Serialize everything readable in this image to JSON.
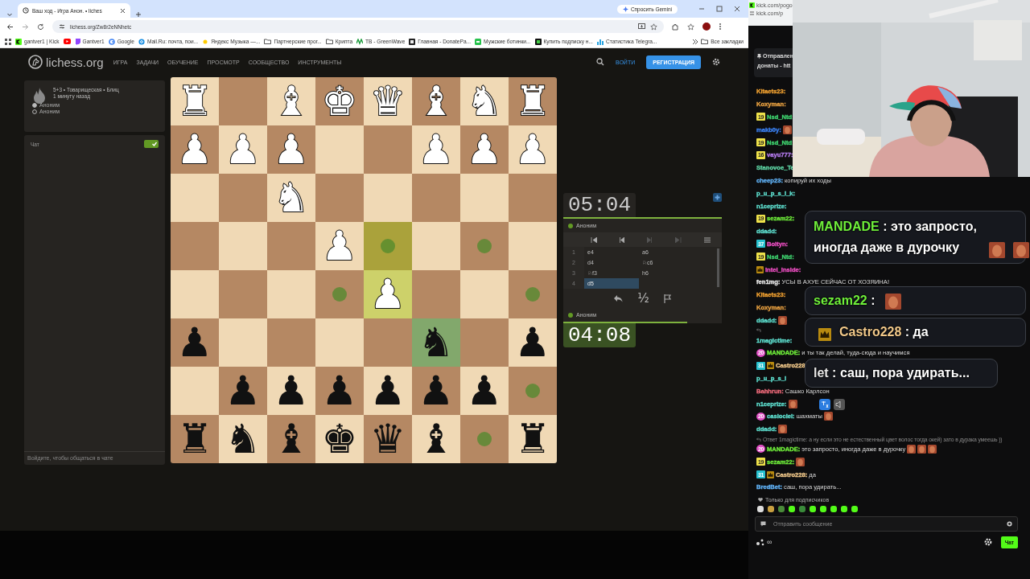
{
  "browser": {
    "tab_title": "Ваш ход - Игра Анон. • liches",
    "url": "lichess.org/Zw8r2eNNhetc",
    "gemini_button": "Спросить Gemini",
    "bookmarks": [
      {
        "kind": "kick",
        "label": "gantver1 | Kick"
      },
      {
        "kind": "youtube"
      },
      {
        "kind": "twitch",
        "label": "Gantver1"
      },
      {
        "kind": "google",
        "label": "Google"
      },
      {
        "kind": "mail",
        "label": "Mail.Ru: почта, пои..."
      },
      {
        "kind": "yandex",
        "label": "Яндекс Музыка —..."
      },
      {
        "kind": "folder",
        "label": "Партнерские прог..."
      },
      {
        "kind": "folder",
        "label": "Крипта"
      },
      {
        "kind": "greenwave",
        "label": "TB - GreenWave"
      },
      {
        "kind": "donate",
        "label": "Главная - DonatePa..."
      },
      {
        "kind": "shoe",
        "label": "Мужские ботинки..."
      },
      {
        "kind": "bot",
        "label": "Купить подписку н..."
      },
      {
        "kind": "stats",
        "label": "Статистика Telegra..."
      }
    ],
    "all_bookmarks": "Все закладки"
  },
  "site": {
    "logo": "lichess.org",
    "nav": [
      "ИГРА",
      "ЗАДАЧИ",
      "ОБУЧЕНИЕ",
      "ПРОСМОТР",
      "СООБЩЕСТВО",
      "ИНСТРУМЕНТЫ"
    ],
    "login": "ВОЙТИ",
    "signup": "РЕГИСТРАЦИЯ"
  },
  "game": {
    "info": "5+3 • Товарищеская • Блиц",
    "time_ago": "1 минуту назад",
    "players": [
      {
        "name": "Аноним",
        "white": true
      },
      {
        "name": "Аноним",
        "white": false
      }
    ]
  },
  "chat": {
    "title": "Чат",
    "on": true,
    "hint": "Войдите, чтобы общаться в чате"
  },
  "board": {
    "rows": [
      [
        {
          "piece": "♜",
          "white": true,
          "dot": false,
          "last_move": false,
          "selected": false
        },
        {
          "dot": false,
          "last_move": false,
          "selected": false
        },
        {
          "piece": "♝",
          "white": true,
          "dot": false,
          "last_move": false,
          "selected": false
        },
        {
          "piece": "♚",
          "white": true,
          "dot": false,
          "last_move": false,
          "selected": false
        },
        {
          "piece": "♛",
          "white": true,
          "dot": false,
          "last_move": false,
          "selected": false
        },
        {
          "piece": "♝",
          "white": true,
          "dot": false,
          "last_move": false,
          "selected": false
        },
        {
          "piece": "♞",
          "white": true,
          "dot": false,
          "last_move": false,
          "selected": false
        },
        {
          "piece": "♜",
          "white": true,
          "dot": false,
          "last_move": false,
          "selected": false
        }
      ],
      [
        {
          "piece": "♟",
          "white": true,
          "dot": false,
          "last_move": false,
          "selected": false
        },
        {
          "piece": "♟",
          "white": true,
          "dot": false,
          "last_move": false,
          "selected": false
        },
        {
          "piece": "♟",
          "white": true,
          "dot": false,
          "last_move": false,
          "selected": false
        },
        {
          "dot": false,
          "last_move": false,
          "selected": false
        },
        {
          "dot": false,
          "last_move": false,
          "selected": false
        },
        {
          "piece": "♟",
          "white": true,
          "dot": false,
          "last_move": false,
          "selected": false
        },
        {
          "piece": "♟",
          "white": true,
          "dot": false,
          "last_move": false,
          "selected": false
        },
        {
          "piece": "♟",
          "white": true,
          "dot": false,
          "last_move": false,
          "selected": false
        }
      ],
      [
        {
          "dot": false,
          "last_move": false,
          "selected": false
        },
        {
          "dot": false,
          "last_move": false,
          "selected": false
        },
        {
          "piece": "♞",
          "white": true,
          "dot": false,
          "last_move": false,
          "selected": false
        },
        {
          "dot": false,
          "last_move": false,
          "selected": false
        },
        {
          "dot": false,
          "last_move": false,
          "selected": false
        },
        {
          "dot": false,
          "last_move": false,
          "selected": false
        },
        {
          "dot": false,
          "last_move": false,
          "selected": false
        },
        {
          "dot": false,
          "last_move": false,
          "selected": false
        }
      ],
      [
        {
          "dot": false,
          "last_move": false,
          "selected": false
        },
        {
          "dot": false,
          "last_move": false,
          "selected": false
        },
        {
          "dot": false,
          "last_move": false,
          "selected": false
        },
        {
          "piece": "♟",
          "white": true,
          "dot": false,
          "last_move": false,
          "selected": false
        },
        {
          "dot": true,
          "last_move": true,
          "selected": false
        },
        {
          "dot": false,
          "last_move": false,
          "selected": false
        },
        {
          "dot": true,
          "last_move": false,
          "selected": false
        },
        {
          "dot": false,
          "last_move": false,
          "selected": false
        }
      ],
      [
        {
          "dot": false,
          "last_move": false,
          "selected": false
        },
        {
          "dot": false,
          "last_move": false,
          "selected": false
        },
        {
          "dot": false,
          "last_move": false,
          "selected": false
        },
        {
          "dot": true,
          "last_move": false,
          "selected": false
        },
        {
          "piece": "♟",
          "white": true,
          "dot": false,
          "last_move": true,
          "selected": false
        },
        {
          "dot": false,
          "last_move": false,
          "selected": false
        },
        {
          "dot": false,
          "last_move": false,
          "selected": false
        },
        {
          "dot": true,
          "last_move": false,
          "selected": false
        }
      ],
      [
        {
          "piece": "♟",
          "white": false,
          "dot": false,
          "last_move": false,
          "selected": false
        },
        {
          "dot": false,
          "last_move": false,
          "selected": false
        },
        {
          "dot": false,
          "last_move": false,
          "selected": false
        },
        {
          "dot": false,
          "last_move": false,
          "selected": false
        },
        {
          "dot": false,
          "last_move": false,
          "selected": false
        },
        {
          "piece": "♞",
          "white": false,
          "dot": false,
          "last_move": false,
          "selected": true
        },
        {
          "dot": false,
          "last_move": false,
          "selected": false
        },
        {
          "piece": "♟",
          "white": false,
          "dot": false,
          "last_move": false,
          "selected": false
        }
      ],
      [
        {
          "dot": false,
          "last_move": false,
          "selected": false
        },
        {
          "piece": "♟",
          "white": false,
          "dot": false,
          "last_move": false,
          "selected": false
        },
        {
          "piece": "♟",
          "white": false,
          "dot": false,
          "last_move": false,
          "selected": false
        },
        {
          "piece": "♟",
          "white": false,
          "dot": false,
          "last_move": false,
          "selected": false
        },
        {
          "piece": "♟",
          "white": false,
          "dot": false,
          "last_move": false,
          "selected": false
        },
        {
          "piece": "♟",
          "white": false,
          "dot": false,
          "last_move": false,
          "selected": false
        },
        {
          "piece": "♟",
          "white": false,
          "dot": false,
          "last_move": false,
          "selected": false
        },
        {
          "dot": true,
          "last_move": false,
          "selected": false
        }
      ],
      [
        {
          "piece": "♜",
          "white": false,
          "dot": false,
          "last_move": false,
          "selected": false
        },
        {
          "piece": "♞",
          "white": false,
          "dot": false,
          "last_move": false,
          "selected": false
        },
        {
          "piece": "♝",
          "white": false,
          "dot": false,
          "last_move": false,
          "selected": false
        },
        {
          "piece": "♚",
          "white": false,
          "dot": false,
          "last_move": false,
          "selected": false
        },
        {
          "piece": "♛",
          "white": false,
          "dot": false,
          "last_move": false,
          "selected": false
        },
        {
          "piece": "♝",
          "white": false,
          "dot": false,
          "last_move": false,
          "selected": false
        },
        {
          "dot": true,
          "last_move": false,
          "selected": false
        },
        {
          "piece": "♜",
          "white": false,
          "dot": false,
          "last_move": false,
          "selected": false
        }
      ]
    ]
  },
  "clocks": [
    {
      "player": "Аноним",
      "time": "05:04",
      "active": false,
      "level": 1
    },
    {
      "player": "Аноним",
      "time": "04:08",
      "active": true,
      "level": 0.78
    }
  ],
  "moves": [
    {
      "number": "1",
      "plies": [
        {
          "san": "e4",
          "selected": false
        },
        {
          "san": "a6",
          "selected": false
        }
      ]
    },
    {
      "number": "2",
      "plies": [
        {
          "san": "d4",
          "selected": false
        },
        {
          "san": "♘c6",
          "selected": false
        }
      ]
    },
    {
      "number": "3",
      "plies": [
        {
          "san": "♘f3",
          "selected": false
        },
        {
          "san": "h6",
          "selected": false
        }
      ]
    },
    {
      "number": "4",
      "plies": [
        {
          "san": "d5",
          "selected": true
        }
      ]
    }
  ],
  "draw_offer": "½",
  "stream": {
    "kick_urls": [
      "kick.com/pogo",
      "kick.com/p"
    ],
    "pinned": [
      "Отправлен",
      "донаты - htt"
    ],
    "messages": [
      {
        "kind": "message",
        "user": "Kitaets23:",
        "color": "#f0a030"
      },
      {
        "kind": "message",
        "user": "Koxyman:",
        "color": "#e8a040"
      },
      {
        "kind": "message",
        "user": "Nsd_Ntd:",
        "color": "#3fd46f",
        "badges": [
          {
            "kind": "gold",
            "label": "19"
          }
        ]
      },
      {
        "kind": "message",
        "user": "makb0y:",
        "color": "#3b82f6",
        "emotes": [
          {
            "kind": "face"
          }
        ]
      },
      {
        "kind": "message",
        "user": "Nsd_Ntd:",
        "color": "#3fd46f",
        "badges": [
          {
            "kind": "gold",
            "label": "19"
          }
        ]
      },
      {
        "kind": "message",
        "user": "vayu777:",
        "color": "#b67cf0",
        "badges": [
          {
            "kind": "gold",
            "label": "16"
          }
        ]
      },
      {
        "kind": "message",
        "user": "Stanovoe_Te",
        "color": "#5fd6a5"
      },
      {
        "kind": "message",
        "user": "cheep23:",
        "color": "#61b3f8",
        "text": "копируй их ходы"
      },
      {
        "kind": "message",
        "user": "p_u_p_s_i_k:",
        "color": "#5ee0d0"
      },
      {
        "kind": "message",
        "user": "n1ceprize:",
        "color": "#5ee0d0"
      },
      {
        "kind": "message",
        "user": "sezam22:",
        "color": "#6fef3a",
        "badges": [
          {
            "kind": "gold",
            "label": "19"
          }
        ]
      },
      {
        "kind": "message",
        "user": "ddadd:",
        "color": "#5ee0d0"
      },
      {
        "kind": "message",
        "user": "Boltyn:",
        "color": "#ef4fc4",
        "badges": [
          {
            "kind": "teal",
            "label": "37"
          }
        ]
      },
      {
        "kind": "message",
        "user": "Nsd_Ntd:",
        "color": "#3fd46f",
        "badges": [
          {
            "kind": "gold",
            "label": "19"
          }
        ]
      },
      {
        "kind": "message",
        "user": "intel_inside:",
        "color": "#ef4fc4",
        "badges": [
          {
            "kind": "crown"
          }
        ]
      },
      {
        "kind": "message",
        "user": "fen1mg:",
        "color": "#e8e8e8",
        "text": "УСЫ В АХУЕ СЕЙЧАС ОТ ХОЗЯИНА!"
      },
      {
        "kind": "message",
        "user": "Kitaets23:",
        "color": "#f0a030"
      },
      {
        "kind": "message",
        "user": "Koxyman:",
        "color": "#e8a040"
      },
      {
        "kind": "message",
        "user": "ddadd:",
        "color": "#5ee0d0",
        "emotes": [
          {
            "kind": "face"
          }
        ]
      },
      {
        "kind": "reply"
      },
      {
        "kind": "message",
        "user": "1magictime:",
        "color": "#5ee0d0"
      },
      {
        "kind": "message",
        "user": "MANDADE:",
        "color": "#6fef3a",
        "badges": [
          {
            "kind": "pink",
            "label": "20"
          }
        ],
        "text": "и ты так делай, туда-сюда и научимся"
      },
      {
        "kind": "message",
        "user": "Castro228:",
        "color": "#f2c98a",
        "badges": [
          {
            "kind": "teal",
            "label": "31"
          },
          {
            "kind": "crown"
          }
        ]
      },
      {
        "kind": "message",
        "user": "p_u_p_s_i",
        "color": "#5ee0d0"
      },
      {
        "kind": "message",
        "user": "Bahhrun:",
        "color": "#ef6a7a",
        "text": "Сашко Карлсон"
      },
      {
        "kind": "message",
        "user": "n1ceprize:",
        "color": "#5ee0d0",
        "emotes": [
          {
            "kind": "face"
          }
        ]
      },
      {
        "kind": "message",
        "user": "casiociel:",
        "color": "#5ee0d0",
        "badges": [
          {
            "kind": "pink",
            "label": "20"
          }
        ],
        "text": "шахматы",
        "emotes": [
          {
            "kind": "face"
          }
        ]
      },
      {
        "kind": "message",
        "user": "ddadd:",
        "color": "#5ee0d0",
        "emotes": [
          {
            "kind": "face"
          }
        ]
      },
      {
        "kind": "reply",
        "text": "Ответ 1magictime: а ну если это не естественный цвет волос тогда окей) зато в дурака умеешь ))"
      },
      {
        "kind": "message",
        "user": "MANDADE:",
        "color": "#6fef3a",
        "badges": [
          {
            "kind": "pink",
            "label": "20"
          }
        ],
        "text": "это запросто, иногда даже в дурочку",
        "emotes": [
          {
            "kind": "face"
          },
          {
            "kind": "face"
          },
          {
            "kind": "face"
          }
        ]
      },
      {
        "kind": "message",
        "user": "sezam22:",
        "color": "#6fef3a",
        "badges": [
          {
            "kind": "gold",
            "label": "19"
          }
        ],
        "emotes": [
          {
            "kind": "face"
          }
        ]
      },
      {
        "kind": "message",
        "user": "Castro228:",
        "color": "#f2c98a",
        "badges": [
          {
            "kind": "teal",
            "label": "31"
          },
          {
            "kind": "crown"
          }
        ],
        "text": "да"
      },
      {
        "kind": "message",
        "user": "BredBet:",
        "color": "#61b3f8",
        "text": "саш, пора удирать..."
      }
    ],
    "overlays": [
      {
        "user": "MANDADE",
        "color": "#6fef3a",
        "text": " : это запросто, иногда даже в дурочку",
        "emotes": [
          {
            "kind": "face"
          },
          {
            "kind": "face"
          }
        ]
      },
      {
        "user": "sezam22",
        "color": "#6fef3a",
        "text": " :",
        "emotes": [
          {
            "kind": "face"
          }
        ]
      },
      {
        "user": "Castro228",
        "color": "#f2c98a",
        "text": " : да",
        "badges": [
          {
            "kind": "crown"
          }
        ]
      },
      {
        "user": "let",
        "color": "#e8e8e8",
        "text": " : саш, пора удирать..."
      }
    ],
    "subscriber_note": "Только для подписчиков",
    "input_placeholder": "Отправить сообщение",
    "viewers": "∞",
    "chat_button": "Чат",
    "webcam": {
      "kind": "picture"
    }
  }
}
